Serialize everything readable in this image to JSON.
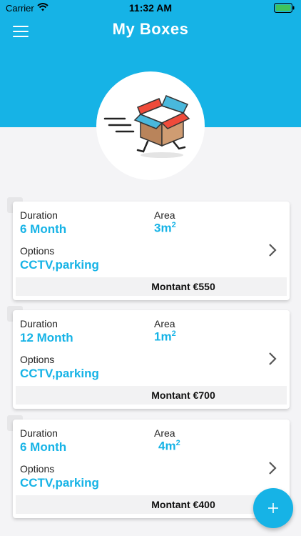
{
  "status_bar": {
    "carrier": "Carrier",
    "time": "11:32 AM"
  },
  "header": {
    "title": "My Boxes"
  },
  "colors": {
    "accent": "#16b3e6",
    "box_lid_red": "#ef4b3a",
    "box_lid_blue": "#49b8dc",
    "box_brown": "#c9936a"
  },
  "boxes": [
    {
      "duration_label": "Duration",
      "duration": "6 Month",
      "area_label": "Area",
      "area": "3m",
      "area_unit": "2",
      "options_label": "Options",
      "options": "CCTV,parking",
      "amount": "Montant €550"
    },
    {
      "duration_label": "Duration",
      "duration": "12 Month",
      "area_label": "Area",
      "area": "1m",
      "area_unit": "2",
      "options_label": "Options",
      "options": "CCTV,parking",
      "amount": "Montant €700"
    },
    {
      "duration_label": "Duration",
      "duration": "6 Month",
      "area_label": "Area",
      "area": "4m",
      "area_unit": "2",
      "options_label": "Options",
      "options": "CCTV,parking",
      "amount": "Montant €400"
    }
  ],
  "icons": {
    "menu": "hamburger-menu-icon",
    "chevron": "chevron-right-icon",
    "add": "plus-icon",
    "logo": "running-box-logo"
  }
}
